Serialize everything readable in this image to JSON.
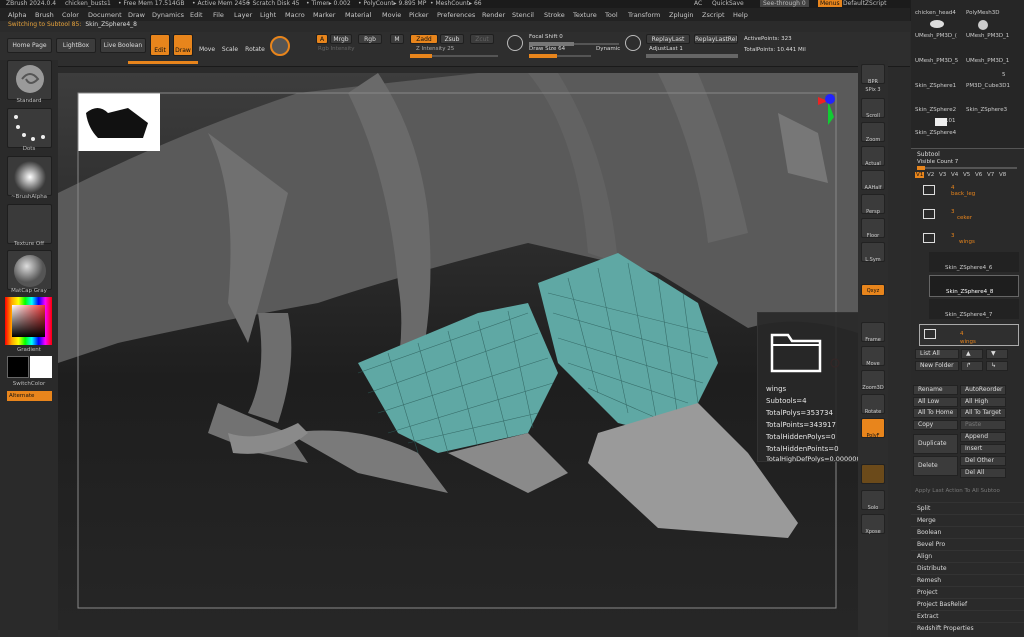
{
  "titlebar": {
    "app": "ZBrush 2024.0.4",
    "file": "chicken_busts1",
    "free_mem": "• Free Mem 17.514GB",
    "active_mem": "• Active Mem 2456",
    "scratch": "• Scratch Disk 45",
    "timer": "• Timer▸ 0.002",
    "polycount": "• PolyCount▸ 9.895 MP",
    "meshcount": "• MeshCount▸ 66",
    "ac": "AC",
    "quicksave": "QuickSave",
    "see_through": "See-through  0",
    "menus": "Menus",
    "script": "DefaultZScript"
  },
  "menu": [
    "Alpha",
    "Brush",
    "Color",
    "Document",
    "Draw",
    "Dynamics",
    "Edit",
    "File",
    "Layer",
    "Light",
    "Macro",
    "Marker",
    "Material",
    "Movie",
    "Picker",
    "Preferences",
    "Render",
    "Stencil",
    "Stroke",
    "Texture",
    "Tool",
    "Transform",
    "Zplugin",
    "Zscript",
    "Help"
  ],
  "status": {
    "prefix": "Switching to Subtool 85:",
    "name": "Skin_ZSphere4_8"
  },
  "toolbar": {
    "home": "Home Page",
    "lightbox": "LightBox",
    "live_boolean": "Live Boolean",
    "edit": "Edit",
    "draw": "Draw",
    "move": "Move",
    "scale": "Scale",
    "rotate": "Rotate",
    "a": "A",
    "mrgb": "Mrgb",
    "rgb": "Rgb",
    "m": "M",
    "zadd": "Zadd",
    "zsub": "Zsub",
    "zcut": "Zcut",
    "rgb_intensity": "Rgb Intensity",
    "z_intensity": "Z Intensity 25",
    "focal_shift": "Focal Shift 0",
    "draw_size": "Draw Size 64",
    "dynamic": "Dynamic",
    "replay_last": "ReplayLast",
    "replay_last_rel": "ReplayLastRel",
    "adjust_last": "AdjustLast 1",
    "active_points": "ActivePoints: 323",
    "total_points": "TotalPoints: 10.441 Mil"
  },
  "left": {
    "standard": "Standard",
    "dots": "Dots",
    "brush_alpha": "~BrushAlpha",
    "texture_off": "Texture Off",
    "matcap": "MatCap Gray",
    "gradient": "Gradient",
    "switch_color": "SwitchColor",
    "alternate": "Alternate"
  },
  "shelf": [
    "BPR",
    "SPix 3",
    "Scroll",
    "Zoom",
    "Actual",
    "AAHalf",
    "Persp",
    "Floor",
    "L.Sym",
    "Qxyz",
    "",
    "Frame",
    "Move",
    "Zoom3D",
    "Rotate",
    "PolyF",
    "",
    "Transp",
    "Solo",
    "Xpose"
  ],
  "popup": {
    "name": "wings",
    "subtools": "Subtools=4",
    "polys": "TotalPolys=353734",
    "points": "TotalPoints=343917",
    "hidden_polys": "TotalHiddenPolys=0",
    "hidden_points": "TotalHiddenPoints=0",
    "highdef": "TotalHighDefPolys=0.0000000 Mil"
  },
  "tools": [
    "chicken_head4",
    "PolyMesh3D",
    "UMesh_PM3D_(",
    "UMesh_PM3D_1",
    "UMesh_PM3D_5",
    "UMesh_PM3D_1",
    "Skin_ZSphere1",
    "PM3D_Cube3D1",
    "Skin_ZSphere2",
    "Skin_ZSphere3",
    "Skin_ZSphere4",
    "5",
    "101"
  ],
  "subtool": {
    "title": "Subtool",
    "visible": "Visible Count 7",
    "versions": [
      "V1",
      "V2",
      "V3",
      "V4",
      "V5",
      "V6",
      "V7",
      "V8"
    ],
    "items": [
      "back_leg",
      "ceker",
      "wings",
      "Skin_ZSphere4_6",
      "Skin_ZSphere4_8",
      "Skin_ZSphere4_7",
      "wings"
    ],
    "counts": [
      "4",
      "3",
      "3",
      "",
      "",
      "",
      "4"
    ]
  },
  "actions": {
    "list_all": "List All",
    "new_folder": "New Folder",
    "rename": "Rename",
    "auto_reorder": "AutoReorder",
    "all_low": "All Low",
    "all_high": "All High",
    "all_to_home": "All To Home",
    "all_to_target": "All To Target",
    "copy": "Copy",
    "paste": "Paste",
    "duplicate": "Duplicate",
    "append": "Append",
    "insert": "Insert",
    "delete": "Delete",
    "del_other": "Del Other",
    "del_all": "Del All",
    "apply_last": "Apply Last Action To All Subtoo",
    "split": "Split",
    "merge": "Merge",
    "boolean": "Boolean",
    "bevel_pro": "Bevel Pro",
    "align": "Align",
    "distribute": "Distribute",
    "remesh": "Remesh",
    "project": "Project",
    "project_bas_relief": "Project BasRelief",
    "extract": "Extract",
    "redshift": "Redshift Properties"
  },
  "colors": {
    "accent": "#e8851c",
    "mesh": "#5fa8a4"
  }
}
